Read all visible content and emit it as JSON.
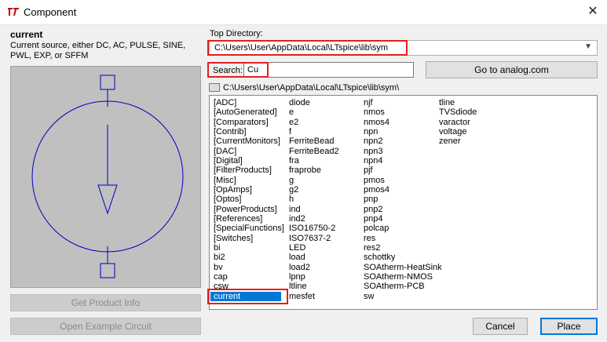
{
  "window": {
    "title": "Component",
    "close": "✕"
  },
  "component": {
    "name": "current",
    "description": "Current source, either DC, AC, PULSE, SINE, PWL, EXP, or SFFM"
  },
  "buttons": {
    "get_product_info": "Get Product Info",
    "open_example": "Open Example Circuit",
    "goto_analog": "Go to analog.com",
    "cancel": "Cancel",
    "place": "Place"
  },
  "top_directory": {
    "label": "Top Directory:",
    "value": "C:\\Users\\User\\AppData\\Local\\LTspice\\lib\\sym"
  },
  "search": {
    "label": "Search:",
    "value": "Cu"
  },
  "current_path": "C:\\Users\\User\\AppData\\Local\\LTspice\\lib\\sym\\",
  "list": {
    "col1": [
      "[ADC]",
      "[AutoGenerated]",
      "[Comparators]",
      "[Contrib]",
      "[CurrentMonitors]",
      "[DAC]",
      "[Digital]",
      "[FilterProducts]",
      "[Misc]",
      "[OpAmps]",
      "[Optos]",
      "[PowerProducts]",
      "[References]",
      "[SpecialFunctions]",
      "[Switches]",
      "bi",
      "bi2",
      "bv",
      "cap",
      "csw",
      "current"
    ],
    "col2": [
      "diode",
      "e",
      "e2",
      "f",
      "FerriteBead",
      "FerriteBead2",
      "fra",
      "fraprobe",
      "g",
      "g2",
      "h",
      "ind",
      "ind2",
      "ISO16750-2",
      "ISO7637-2",
      "LED",
      "load",
      "load2",
      "lpnp",
      "ltline",
      "mesfet"
    ],
    "col3": [
      "njf",
      "nmos",
      "nmos4",
      "npn",
      "npn2",
      "npn3",
      "npn4",
      "pjf",
      "pmos",
      "pmos4",
      "pnp",
      "pnp2",
      "pnp4",
      "polcap",
      "res",
      "res2",
      "schottky",
      "SOAtherm-HeatSink",
      "SOAtherm-NMOS",
      "SOAtherm-PCB",
      "sw"
    ],
    "col4": [
      "tline",
      "TVSdiode",
      "varactor",
      "voltage",
      "zener"
    ],
    "selected": "current"
  },
  "colors": {
    "highlight": "#e02020",
    "selection": "#0078d7",
    "symbol": "#0000c0"
  }
}
